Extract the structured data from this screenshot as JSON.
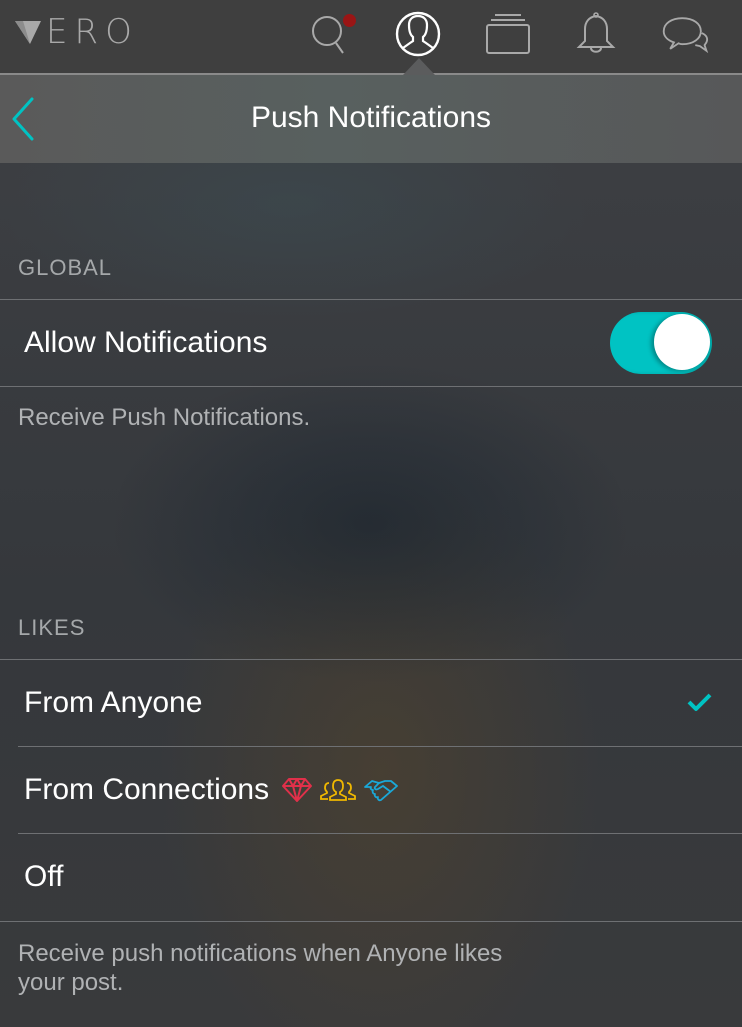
{
  "app": {
    "logo_text": "ERO",
    "brand_name": "VERO",
    "nav_icons": [
      "search-icon",
      "profile-icon",
      "collections-icon",
      "bell-icon",
      "chat-icon"
    ],
    "active_nav": "profile-icon",
    "search_has_badge": true
  },
  "header": {
    "title": "Push Notifications",
    "back_icon": "chevron-left-icon"
  },
  "global": {
    "section_label": "GLOBAL",
    "allow_notifications": {
      "label": "Allow Notifications",
      "enabled": true
    },
    "description": "Receive Push Notifications."
  },
  "likes": {
    "section_label": "LIKES",
    "options": [
      {
        "label": "From Anyone",
        "selected": true
      },
      {
        "label": "From Connections",
        "selected": false,
        "icons": [
          "diamond-icon",
          "group-icon",
          "handshake-icon"
        ]
      },
      {
        "label": "Off",
        "selected": false
      }
    ],
    "description_line1": "Receive push notifications when Anyone likes",
    "description_line2": "your post."
  },
  "colors": {
    "accent": "#00c3c3",
    "badge": "#9a1515",
    "diamond": "#e0304a",
    "group": "#f0b800",
    "handshake": "#1aa8d8"
  }
}
